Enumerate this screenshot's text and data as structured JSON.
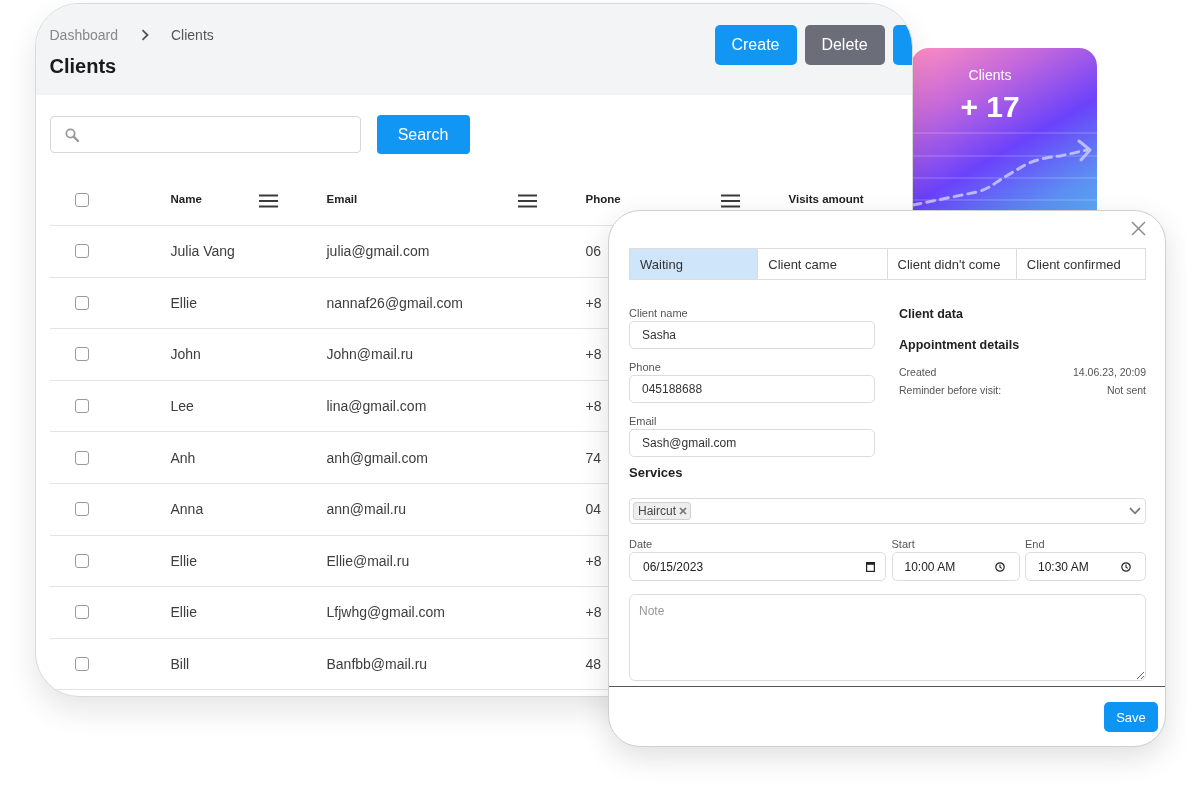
{
  "stats_card": {
    "title": "Clients",
    "value": "+ 17"
  },
  "breadcrumb": [
    {
      "label": "Dashboard"
    },
    {
      "label": "Clients"
    }
  ],
  "page_title": "Clients",
  "actions": [
    {
      "label": "Create",
      "kind": "primary"
    },
    {
      "label": "Delete",
      "kind": "secondary"
    },
    {
      "kind": "primary"
    }
  ],
  "search": {
    "button": "Search"
  },
  "table": {
    "header_checkbox": {
      "checked": false
    },
    "columns": [
      {
        "label": "Name",
        "menu": true
      },
      {
        "label": "Email",
        "menu": true
      },
      {
        "label": "Phone",
        "menu": true
      },
      {
        "label": "Visits amount",
        "menu": false
      }
    ],
    "rows": [
      {
        "checked": false,
        "name": "Julia Vang",
        "email": "julia@gmail.com",
        "phone": "06"
      },
      {
        "checked": false,
        "name": "Ellie",
        "email": "nannaf26@gmail.com",
        "phone": "+8"
      },
      {
        "checked": false,
        "name": "John",
        "email": "John@mail.ru",
        "phone": "+8"
      },
      {
        "checked": false,
        "name": "Lee",
        "email": "lina@gmail.com",
        "phone": "+8"
      },
      {
        "checked": false,
        "name": "Anh",
        "email": "anh@gmail.com",
        "phone": "74"
      },
      {
        "checked": false,
        "name": "Anna",
        "email": "ann@mail.ru",
        "phone": "04"
      },
      {
        "checked": false,
        "name": "Ellie",
        "email": "Ellie@mail.ru",
        "phone": "+8"
      },
      {
        "checked": false,
        "name": "Ellie",
        "email": "Lfjwhg@gmail.com",
        "phone": "+8"
      },
      {
        "checked": false,
        "name": "Bill",
        "email": "Banfbb@mail.ru",
        "phone": "48"
      }
    ]
  },
  "modal": {
    "status_tabs": [
      {
        "label": "Waiting",
        "selected": true
      },
      {
        "label": "Client came",
        "selected": false
      },
      {
        "label": "Client didn't come",
        "selected": false
      },
      {
        "label": "Client confirmed",
        "selected": false
      }
    ],
    "fields": [
      {
        "label": "Client name",
        "value": "Sasha"
      },
      {
        "label": "Phone",
        "value": "045188688"
      },
      {
        "label": "Email",
        "value": "Sash@gmail.com"
      }
    ],
    "client_data_heading": "Client data",
    "appointment_heading": "Appointment details",
    "details": [
      {
        "label": "Created",
        "value": "14.06.23, 20:09"
      },
      {
        "label": "Reminder before visit:",
        "value": "Not sent"
      }
    ],
    "services": {
      "heading": "Services",
      "tags": [
        {
          "label": "Haircut"
        }
      ]
    },
    "date_time": [
      {
        "label": "Date",
        "value": "06/15/2023",
        "kind": "date"
      },
      {
        "label": "Start",
        "value": "10:00 AM",
        "kind": "time"
      },
      {
        "label": "End",
        "value": "10:30 AM",
        "kind": "time"
      }
    ],
    "note": {
      "placeholder": "Note"
    },
    "save_button": "Save"
  }
}
